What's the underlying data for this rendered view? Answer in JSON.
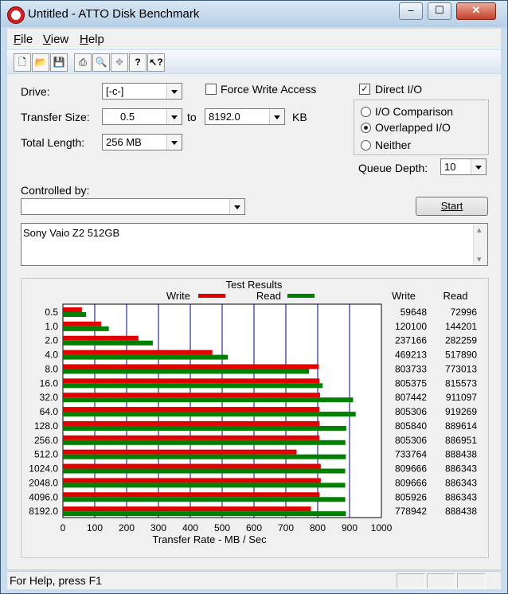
{
  "window": {
    "title": "Untitled - ATTO Disk Benchmark",
    "min": "–",
    "max": "☐",
    "close": "✕"
  },
  "menu": [
    {
      "underline": "F",
      "rest": "ile"
    },
    {
      "underline": "V",
      "rest": "iew"
    },
    {
      "underline": "H",
      "rest": "elp"
    }
  ],
  "toolbar": [
    "new-icon",
    "open-icon",
    "save-icon",
    "print-icon",
    "print-preview-icon",
    "move-icon",
    "help-icon",
    "context-help-icon"
  ],
  "form": {
    "drive_label": "Drive:",
    "drive_value": "[-c-]",
    "force_write_label": "Force Write Access",
    "force_write_checked": false,
    "direct_io_label": "Direct I/O",
    "direct_io_checked": true,
    "transfer_size_label": "Transfer Size:",
    "transfer_from": "0.5",
    "to_label": "to",
    "transfer_to": "8192.0",
    "kb_label": "KB",
    "total_length_label": "Total Length:",
    "total_length": "256 MB",
    "io_comparison_label": "I/O Comparison",
    "overlapped_label": "Overlapped I/O",
    "neither_label": "Neither",
    "selected_mode": "overlapped",
    "queue_depth_label": "Queue Depth:",
    "queue_depth": "10",
    "controlled_by_label": "Controlled by:",
    "controlled_by": "",
    "start_label": "Start",
    "description": "Sony Vaio Z2 512GB"
  },
  "chart_data": {
    "type": "bar",
    "title": "Test Results",
    "xlabel": "Transfer Rate - MB / Sec",
    "xlim": [
      0,
      1000
    ],
    "xticks": [
      0,
      100,
      200,
      300,
      400,
      500,
      600,
      700,
      800,
      900,
      1000
    ],
    "categories": [
      "0.5",
      "1.0",
      "2.0",
      "4.0",
      "8.0",
      "16.0",
      "32.0",
      "64.0",
      "128.0",
      "256.0",
      "512.0",
      "1024.0",
      "2048.0",
      "4096.0",
      "8192.0"
    ],
    "series": [
      {
        "name": "Write",
        "color": "#e00000",
        "values": [
          59648,
          120100,
          237166,
          469213,
          803733,
          805375,
          807442,
          805306,
          805840,
          805306,
          733764,
          809666,
          809666,
          805926,
          778942
        ]
      },
      {
        "name": "Read",
        "color": "#008000",
        "values": [
          72996,
          144201,
          282259,
          517890,
          773013,
          815573,
          911097,
          919269,
          889614,
          886951,
          888438,
          886343,
          886343,
          886343,
          888438
        ]
      }
    ],
    "column_headers": {
      "write": "Write",
      "read": "Read"
    }
  },
  "status": {
    "help_text": "For Help, press F1"
  }
}
